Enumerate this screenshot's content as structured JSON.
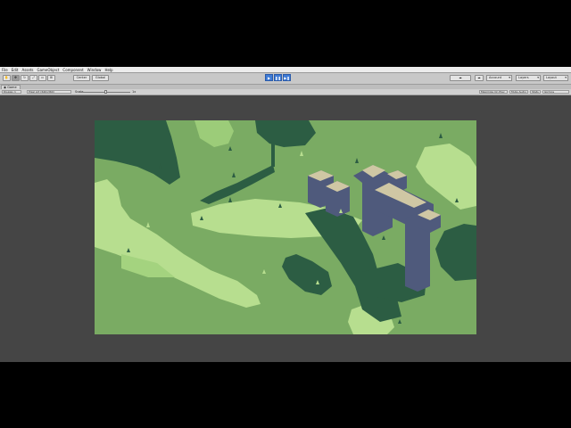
{
  "menu": {
    "items": [
      "File",
      "Edit",
      "Assets",
      "GameObject",
      "Component",
      "Window",
      "Help"
    ]
  },
  "toolbar": {
    "tools": [
      "hand",
      "move",
      "rotate",
      "scale",
      "rect",
      "transform"
    ],
    "pivot_label": "Center",
    "space_label": "Global",
    "play_icons": [
      "▶",
      "❚❚",
      "▶❚"
    ],
    "account_label": "Account",
    "layers_label": "Layers",
    "layout_label": "Layout"
  },
  "game_tab": {
    "label": "Game"
  },
  "game_bar": {
    "display_label": "Display 1",
    "resolution_label": "Pixel Art (640x360)",
    "scale_label": "Scale",
    "scale_value": "1x",
    "maximize_label": "Maximize On Play",
    "mute_label": "Mute Audio",
    "stats_label": "Stats",
    "gizmos_label": "Gizmos"
  },
  "colors": {
    "background_black": "#000000",
    "editor_gray": "#c2c2c2",
    "viewport_dark": "#454545",
    "play_active": "#3e7bd6",
    "grass_mid": "#7aab63",
    "grass_light": "#b7de8f",
    "grass_dark": "#2c5d43",
    "block_slate": "#4f5a7c",
    "block_top": "#cfc7a4"
  }
}
